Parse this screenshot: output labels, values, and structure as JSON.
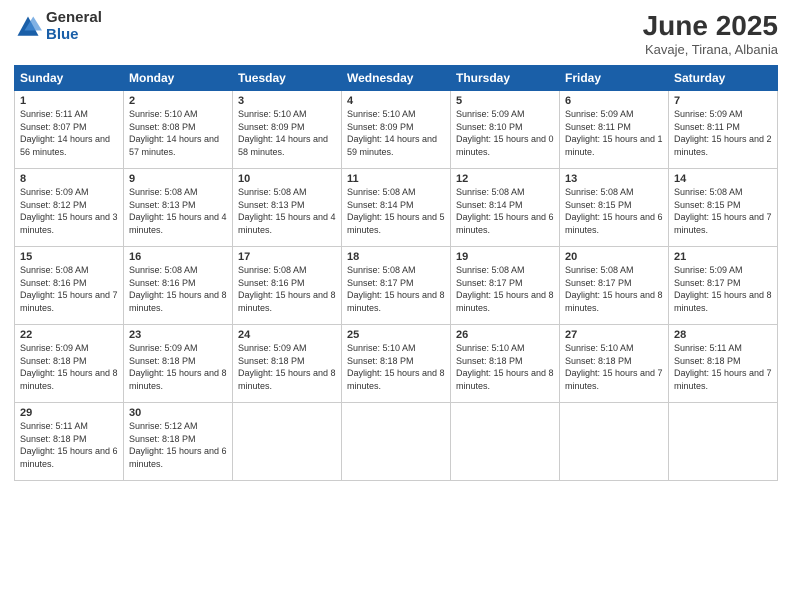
{
  "header": {
    "logo_line1": "General",
    "logo_line2": "Blue",
    "month_year": "June 2025",
    "location": "Kavaje, Tirana, Albania"
  },
  "days_of_week": [
    "Sunday",
    "Monday",
    "Tuesday",
    "Wednesday",
    "Thursday",
    "Friday",
    "Saturday"
  ],
  "weeks": [
    [
      {
        "day": 1,
        "sunrise": "5:11 AM",
        "sunset": "8:07 PM",
        "daylight": "14 hours and 56 minutes."
      },
      {
        "day": 2,
        "sunrise": "5:10 AM",
        "sunset": "8:08 PM",
        "daylight": "14 hours and 57 minutes."
      },
      {
        "day": 3,
        "sunrise": "5:10 AM",
        "sunset": "8:09 PM",
        "daylight": "14 hours and 58 minutes."
      },
      {
        "day": 4,
        "sunrise": "5:10 AM",
        "sunset": "8:09 PM",
        "daylight": "14 hours and 59 minutes."
      },
      {
        "day": 5,
        "sunrise": "5:09 AM",
        "sunset": "8:10 PM",
        "daylight": "15 hours and 0 minutes."
      },
      {
        "day": 6,
        "sunrise": "5:09 AM",
        "sunset": "8:11 PM",
        "daylight": "15 hours and 1 minute."
      },
      {
        "day": 7,
        "sunrise": "5:09 AM",
        "sunset": "8:11 PM",
        "daylight": "15 hours and 2 minutes."
      }
    ],
    [
      {
        "day": 8,
        "sunrise": "5:09 AM",
        "sunset": "8:12 PM",
        "daylight": "15 hours and 3 minutes."
      },
      {
        "day": 9,
        "sunrise": "5:08 AM",
        "sunset": "8:13 PM",
        "daylight": "15 hours and 4 minutes."
      },
      {
        "day": 10,
        "sunrise": "5:08 AM",
        "sunset": "8:13 PM",
        "daylight": "15 hours and 4 minutes."
      },
      {
        "day": 11,
        "sunrise": "5:08 AM",
        "sunset": "8:14 PM",
        "daylight": "15 hours and 5 minutes."
      },
      {
        "day": 12,
        "sunrise": "5:08 AM",
        "sunset": "8:14 PM",
        "daylight": "15 hours and 6 minutes."
      },
      {
        "day": 13,
        "sunrise": "5:08 AM",
        "sunset": "8:15 PM",
        "daylight": "15 hours and 6 minutes."
      },
      {
        "day": 14,
        "sunrise": "5:08 AM",
        "sunset": "8:15 PM",
        "daylight": "15 hours and 7 minutes."
      }
    ],
    [
      {
        "day": 15,
        "sunrise": "5:08 AM",
        "sunset": "8:16 PM",
        "daylight": "15 hours and 7 minutes."
      },
      {
        "day": 16,
        "sunrise": "5:08 AM",
        "sunset": "8:16 PM",
        "daylight": "15 hours and 8 minutes."
      },
      {
        "day": 17,
        "sunrise": "5:08 AM",
        "sunset": "8:16 PM",
        "daylight": "15 hours and 8 minutes."
      },
      {
        "day": 18,
        "sunrise": "5:08 AM",
        "sunset": "8:17 PM",
        "daylight": "15 hours and 8 minutes."
      },
      {
        "day": 19,
        "sunrise": "5:08 AM",
        "sunset": "8:17 PM",
        "daylight": "15 hours and 8 minutes."
      },
      {
        "day": 20,
        "sunrise": "5:08 AM",
        "sunset": "8:17 PM",
        "daylight": "15 hours and 8 minutes."
      },
      {
        "day": 21,
        "sunrise": "5:09 AM",
        "sunset": "8:17 PM",
        "daylight": "15 hours and 8 minutes."
      }
    ],
    [
      {
        "day": 22,
        "sunrise": "5:09 AM",
        "sunset": "8:18 PM",
        "daylight": "15 hours and 8 minutes."
      },
      {
        "day": 23,
        "sunrise": "5:09 AM",
        "sunset": "8:18 PM",
        "daylight": "15 hours and 8 minutes."
      },
      {
        "day": 24,
        "sunrise": "5:09 AM",
        "sunset": "8:18 PM",
        "daylight": "15 hours and 8 minutes."
      },
      {
        "day": 25,
        "sunrise": "5:10 AM",
        "sunset": "8:18 PM",
        "daylight": "15 hours and 8 minutes."
      },
      {
        "day": 26,
        "sunrise": "5:10 AM",
        "sunset": "8:18 PM",
        "daylight": "15 hours and 8 minutes."
      },
      {
        "day": 27,
        "sunrise": "5:10 AM",
        "sunset": "8:18 PM",
        "daylight": "15 hours and 7 minutes."
      },
      {
        "day": 28,
        "sunrise": "5:11 AM",
        "sunset": "8:18 PM",
        "daylight": "15 hours and 7 minutes."
      }
    ],
    [
      {
        "day": 29,
        "sunrise": "5:11 AM",
        "sunset": "8:18 PM",
        "daylight": "15 hours and 6 minutes."
      },
      {
        "day": 30,
        "sunrise": "5:12 AM",
        "sunset": "8:18 PM",
        "daylight": "15 hours and 6 minutes."
      },
      null,
      null,
      null,
      null,
      null
    ]
  ]
}
